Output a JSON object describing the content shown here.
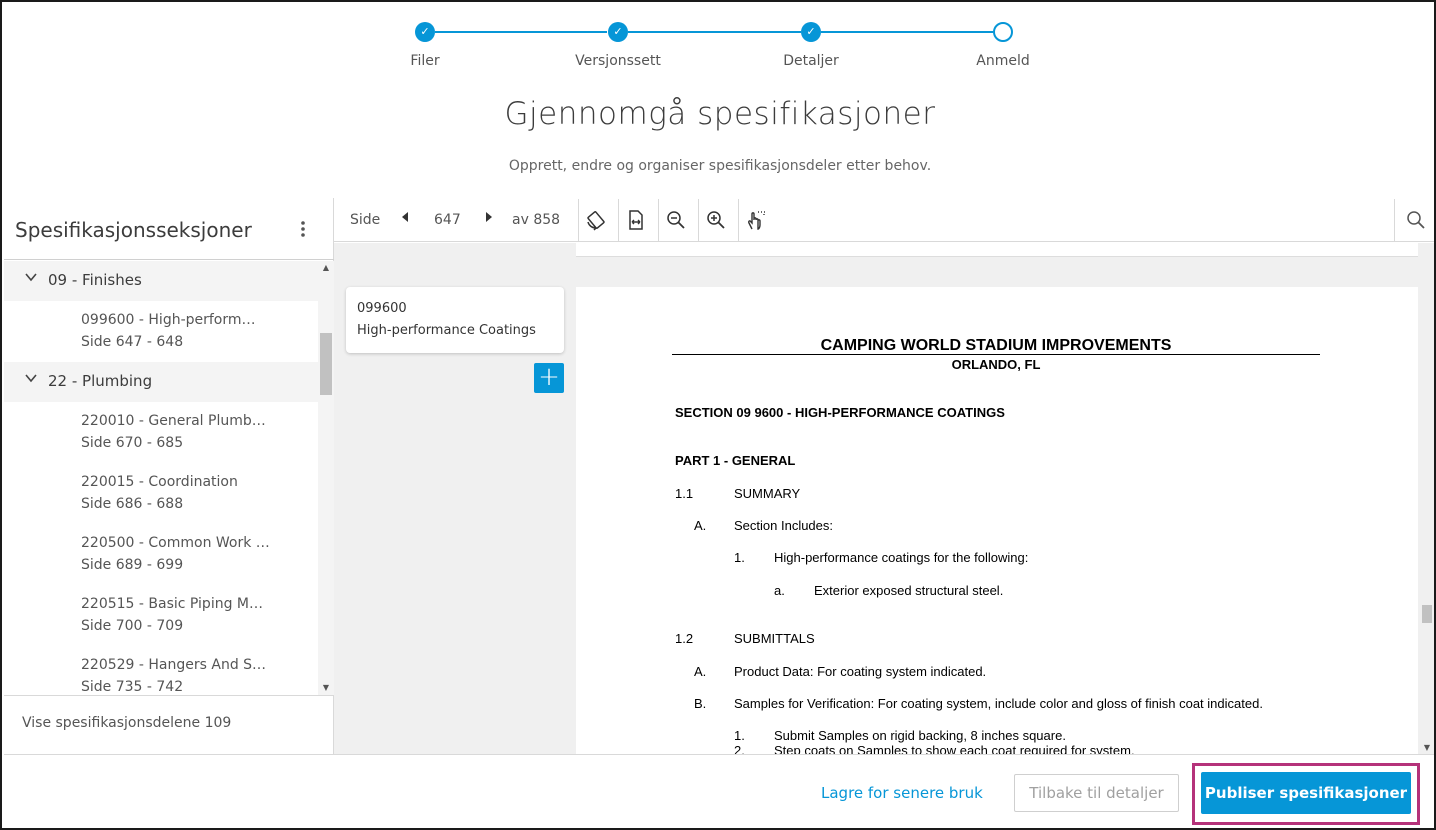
{
  "stepper": {
    "steps": [
      {
        "label": "Filer",
        "state": "done"
      },
      {
        "label": "Versjonssett",
        "state": "done"
      },
      {
        "label": "Detaljer",
        "state": "done"
      },
      {
        "label": "Anmeld",
        "state": "current"
      }
    ],
    "check_glyph": "✓"
  },
  "header": {
    "title": "Gjennomgå spesifikasjoner",
    "subtitle": "Opprett, endre og organiser spesifikasjonsdeler etter behov."
  },
  "sidebar": {
    "title": "Spesifikasjonsseksjoner",
    "menu_glyph": "⋮",
    "groups": [
      {
        "label": "09 - Finishes",
        "items": [
          {
            "name": "099600 - High-perform…",
            "pages": "Side 647 - 648"
          }
        ]
      },
      {
        "label": "22 - Plumbing",
        "items": [
          {
            "name": "220010 - General Plumb…",
            "pages": "Side 670 - 685"
          },
          {
            "name": "220015 - Coordination",
            "pages": "Side 686 - 688"
          },
          {
            "name": "220500 - Common Work …",
            "pages": "Side 689 - 699"
          },
          {
            "name": "220515 - Basic Piping M…",
            "pages": "Side 700 - 709"
          },
          {
            "name": "220529 - Hangers And S…",
            "pages": "Side 735 - 742"
          }
        ]
      }
    ],
    "footer": "Vise spesifikasjonsdelene 109"
  },
  "toolbar": {
    "page_label": "Side",
    "current_page": "647",
    "of_label": "av 858"
  },
  "section_card": {
    "code": "099600",
    "description": "High-performance Coatings",
    "add_glyph": "+"
  },
  "document": {
    "title": "CAMPING WORLD STADIUM IMPROVEMENTS",
    "location": "ORLANDO, FL",
    "section": "SECTION 09 9600 - HIGH-PERFORMANCE COATINGS",
    "part": "PART 1 - GENERAL",
    "lines": [
      {
        "num": "1.1",
        "text": "SUMMARY"
      },
      {
        "num": "A.",
        "text": "Section Includes:"
      },
      {
        "num": "1.",
        "text": "High-performance coatings for the following:"
      },
      {
        "num": "a.",
        "text": "Exterior exposed structural steel."
      },
      {
        "num": "1.2",
        "text": "SUBMITTALS"
      },
      {
        "num": "A.",
        "text": "Product Data:  For coating system indicated."
      },
      {
        "num": "B.",
        "text": "Samples for Verification:  For coating system, include color and gloss of finish coat indicated."
      },
      {
        "num": "1.",
        "text": "Submit Samples on rigid backing, 8 inches square."
      },
      {
        "num": "2.",
        "text": "Step coats on Samples to show each coat required for system."
      }
    ]
  },
  "footer": {
    "save_later": "Lagre for senere bruk",
    "back": "Tilbake til detaljer",
    "publish": "Publiser spesifikasjoner"
  },
  "colors": {
    "accent": "#0696d7",
    "highlight": "#b5327a"
  }
}
